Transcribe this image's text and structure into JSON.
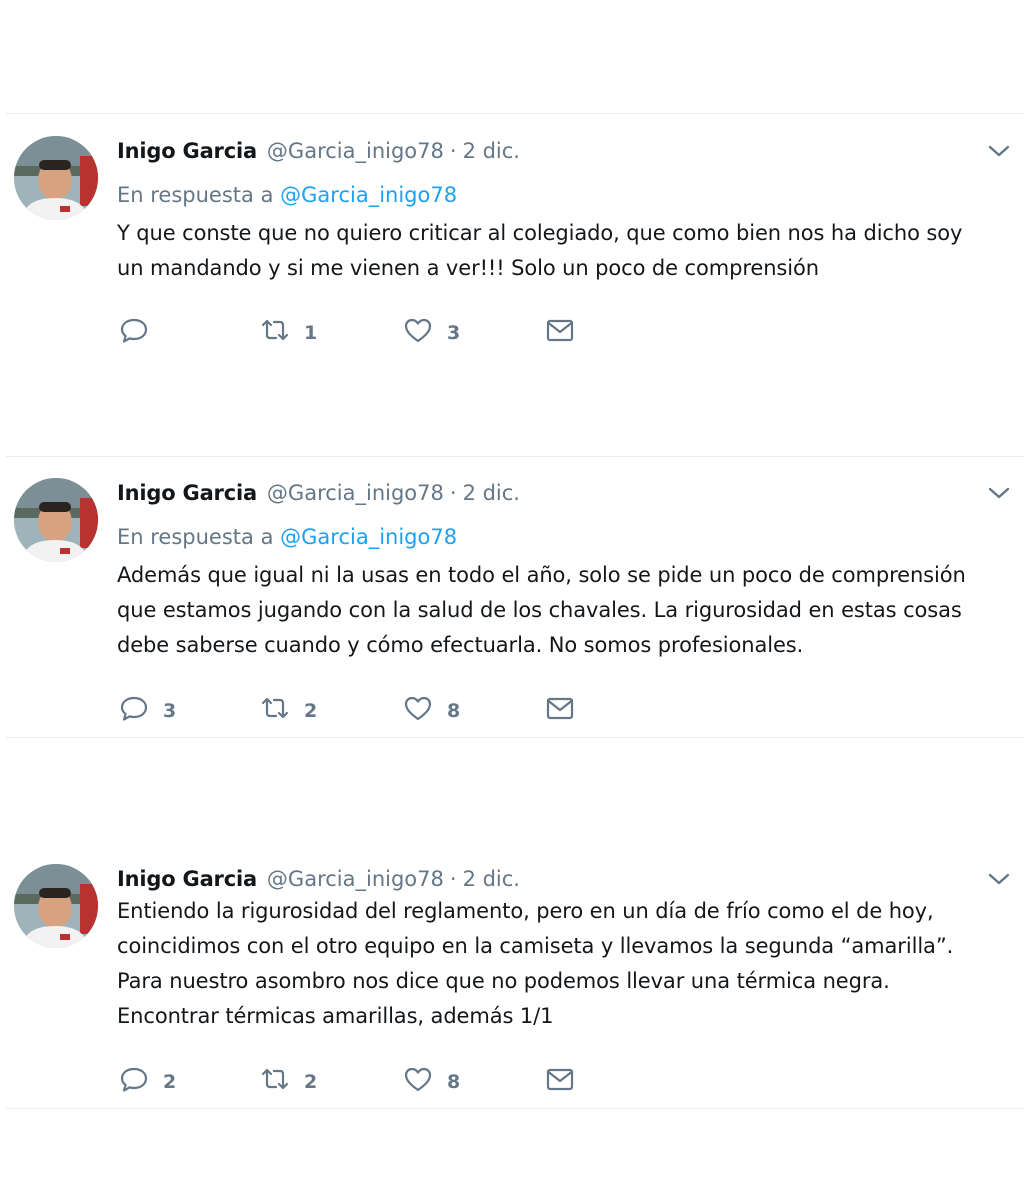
{
  "tweets": [
    {
      "author_name": "Inigo Garcia",
      "handle": "@Garcia_inigo78",
      "separator": "·",
      "date": "2 dic.",
      "reply_prefix": "En respuesta a",
      "reply_to": "@Garcia_inigo78",
      "text_lines": [
        "Y que conste que no quiero criticar al colegiado, que como bien nos ha dicho soy",
        "un mandando y si me vienen a ver!!! Solo un poco de comprensión"
      ],
      "replies": "",
      "retweets": "1",
      "likes": "3"
    },
    {
      "author_name": "Inigo Garcia",
      "handle": "@Garcia_inigo78",
      "separator": "·",
      "date": "2 dic.",
      "reply_prefix": "En respuesta a",
      "reply_to": "@Garcia_inigo78",
      "text_lines": [
        "Además que igual ni la usas en todo el año, solo se pide un poco de comprensión",
        "que estamos jugando con la salud de los chavales. La rigurosidad en estas cosas",
        "debe saberse cuando y cómo efectuarla. No somos profesionales."
      ],
      "replies": "3",
      "retweets": "2",
      "likes": "8"
    },
    {
      "author_name": "Inigo Garcia",
      "handle": "@Garcia_inigo78",
      "separator": "·",
      "date": "2 dic.",
      "text_lines": [
        "Entiendo la rigurosidad del reglamento, pero en un día de frío como el de hoy,",
        "coincidimos con el otro equipo en la camiseta y llevamos la segunda “amarilla”.",
        "Para nuestro asombro nos dice que no podemos llevar una térmica negra.",
        "Encontrar térmicas amarillas, además 1/1"
      ],
      "replies": "2",
      "retweets": "2",
      "likes": "8"
    }
  ],
  "icons": {
    "reply": "reply-icon",
    "retweet": "retweet-icon",
    "like": "heart-icon",
    "dm": "envelope-icon",
    "more": "chevron-down-icon"
  },
  "colors": {
    "text": "#14171a",
    "secondary": "#657786",
    "link": "#1da1f2",
    "divider": "#e6ecf0"
  }
}
